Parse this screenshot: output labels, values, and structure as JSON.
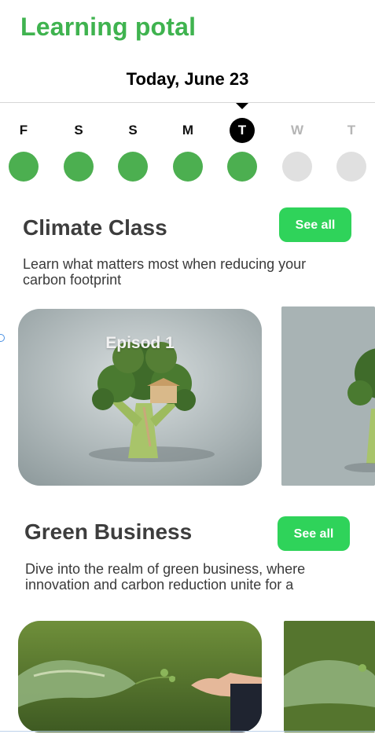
{
  "app": {
    "title": "Learning potal"
  },
  "date": {
    "label": "Today, June 23"
  },
  "week": {
    "days": [
      {
        "letter": "F",
        "state": "done"
      },
      {
        "letter": "S",
        "state": "done"
      },
      {
        "letter": "S",
        "state": "done"
      },
      {
        "letter": "M",
        "state": "done"
      },
      {
        "letter": "T",
        "state": "current"
      },
      {
        "letter": "W",
        "state": "future"
      },
      {
        "letter": "T",
        "state": "future"
      }
    ],
    "colors": {
      "done": "#4caf50",
      "future": "#e0e0e0",
      "current": "#000000"
    }
  },
  "sections": [
    {
      "title": "Climate Class",
      "see_all": "See all",
      "description_line1": "Learn what matters most when reducing your",
      "description_line2": "carbon footprint",
      "cards": [
        {
          "label": "Episod 1",
          "image": "broccoli-treehouse"
        },
        {
          "label": "",
          "image": "broccoli-treehouse"
        }
      ]
    },
    {
      "title": "Green Business",
      "see_all": "See all",
      "description_line1": "Dive into the realm of green business, where",
      "description_line2": "innovation and carbon reduction unite for a",
      "cards": [
        {
          "label": "",
          "image": "nature-handshake"
        },
        {
          "label": "",
          "image": "nature-handshake"
        }
      ]
    }
  ],
  "theme": {
    "accent": "#3fb34f",
    "button": "#2fd35a"
  }
}
